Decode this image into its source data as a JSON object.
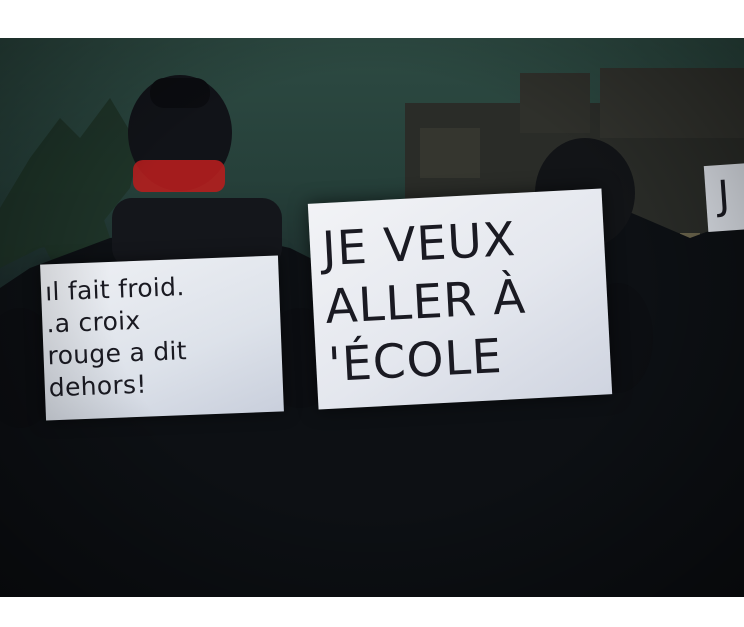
{
  "photo": {
    "signs": [
      {
        "text": "ıl fait froid.\n.a croix\nrouge a dit\ndehors!"
      },
      {
        "text": "JE VEUX\nALLER À\n'ÉCOLE"
      },
      {
        "text": "J"
      }
    ]
  }
}
